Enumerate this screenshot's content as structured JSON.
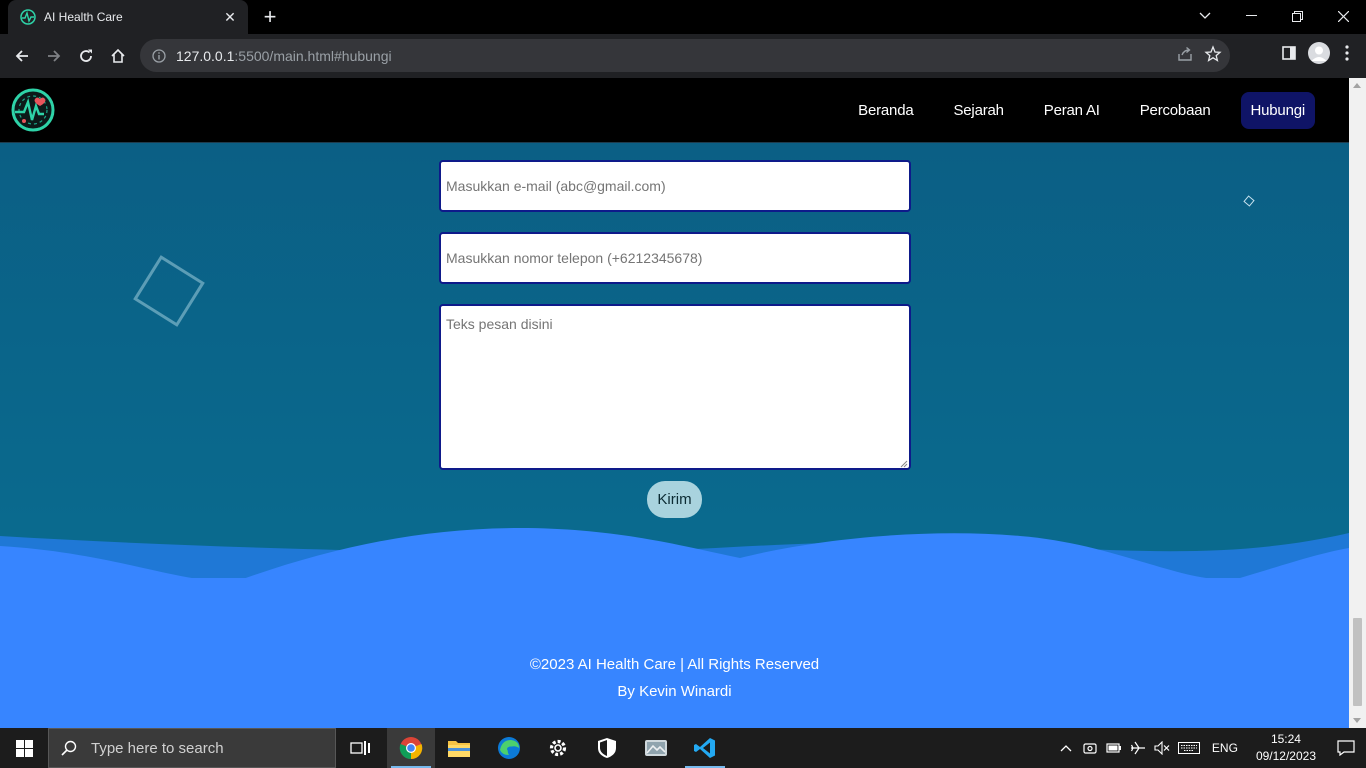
{
  "browser": {
    "tab_title": "AI Health Care",
    "url_host": "127.0.0.1",
    "url_rest": ":5500/main.html#hubungi"
  },
  "nav": {
    "items": [
      {
        "label": "Beranda",
        "active": false
      },
      {
        "label": "Sejarah",
        "active": false
      },
      {
        "label": "Peran AI",
        "active": false
      },
      {
        "label": "Percobaan",
        "active": false
      },
      {
        "label": "Hubungi",
        "active": true
      }
    ]
  },
  "form": {
    "email_placeholder": "Masukkan e-mail (abc@gmail.com)",
    "phone_placeholder": "Masukkan nomor telepon (+6212345678)",
    "message_placeholder": "Teks pesan disini",
    "submit_label": "Kirim"
  },
  "footer": {
    "copyright": "©2023 AI Health Care | All Rights Reserved",
    "author": "By Kevin Winardi"
  },
  "taskbar": {
    "search_placeholder": "Type here to search",
    "language": "ENG",
    "time": "15:24",
    "date": "09/12/2023"
  },
  "colors": {
    "page_top": "#0b5d83",
    "footer": "#3785ff",
    "nav_active": "#0f1466",
    "button": "#a9d3de"
  }
}
